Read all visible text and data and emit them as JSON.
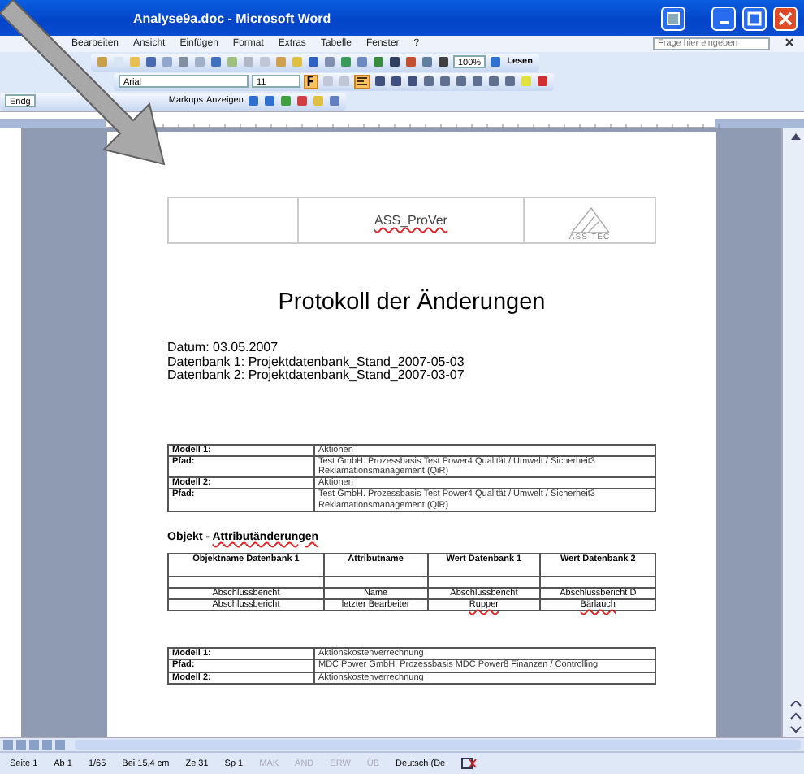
{
  "window": {
    "title": "Analyse9a.doc - Microsoft Word"
  },
  "menu": [
    "Bearbeiten",
    "Ansicht",
    "Einfügen",
    "Format",
    "Extras",
    "Tabelle",
    "Fenster",
    "?"
  ],
  "help_box": {
    "placeholder": "Frage hier eingeben"
  },
  "toolbar": {
    "zoom": "100%",
    "read_button": "Lesen"
  },
  "formatting": {
    "font": "Arial",
    "size": "11",
    "bold": true,
    "align_left": true
  },
  "review": {
    "view": "Endg",
    "markups": "Markups",
    "show": "Anzeigen"
  },
  "document": {
    "header": {
      "title": "ASS_ProVer",
      "title_spell_error": true,
      "logo": "ASS-TEC"
    },
    "heading": "Protokoll der Änderungen",
    "info": [
      "Datum: 03.05.2007",
      "Datenbank 1: Projektdatenbank_Stand_2007-05-03",
      "Datenbank 2: Projektdatenbank_Stand_2007-03-07"
    ],
    "model_tables": [
      {
        "rows": [
          {
            "label": "Modell 1:",
            "value": "Aktionen"
          },
          {
            "label": "Pfad:",
            "value": "Test GmbH. Prozessbasis Test Power4 Qualität / Umwelt / Sicherheit3 Reklamationsmanagement (QiR)"
          },
          {
            "label": "Modell 2:",
            "value": "Aktionen"
          },
          {
            "label": "Pfad:",
            "value": "Test GmbH. Prozessbasis Test Power4 Qualität / Umwelt / Sicherheit3 Reklamationsmanagement (QiR)"
          }
        ]
      }
    ],
    "section_title": "Objekt - ",
    "section_title_link": "Attributänderungen",
    "section_link_spell_error": true,
    "attr_table": {
      "columns": [
        "Objektname Datenbank 1",
        "Attributname",
        "Wert Datenbank 1",
        "Wert Datenbank 2"
      ],
      "rows": [
        [
          {
            "text": "Abschlussbericht",
            "spell_error": false
          },
          {
            "text": "Name",
            "spell_error": false
          },
          {
            "text": "Abschlussbericht",
            "spell_error": false
          },
          {
            "text": "Abschlussbericht D",
            "spell_error": false
          }
        ],
        [
          {
            "text": "Abschlussbericht",
            "spell_error": false
          },
          {
            "text": "letzter Bearbeiter",
            "spell_error": false
          },
          {
            "text": "Rupper",
            "spell_error": true
          },
          {
            "text": "Bärlauch",
            "spell_error": true
          }
        ]
      ]
    },
    "model_tables_2": [
      {
        "rows": [
          {
            "label": "Modell 1:",
            "value": "Aktionskostenverrechnung"
          },
          {
            "label": "Pfad:",
            "value": "MDC Power GmbH. Prozessbasis MDC Power8 Finanzen / Controlling"
          },
          {
            "label": "Modell 2:",
            "value": "Aktionskostenverrechnung"
          }
        ]
      }
    ]
  },
  "status_bar": [
    "Seite 1",
    "Ab 1",
    "1/65",
    "Bei 15,4 cm",
    "Ze 31",
    "Sp 1"
  ],
  "status_flags": [
    {
      "label": "MAK",
      "on": false
    },
    {
      "label": "ÄND",
      "on": false
    },
    {
      "label": "ERW",
      "on": false
    },
    {
      "label": "ÜB",
      "on": false
    }
  ],
  "language": "Deutsch (De"
}
